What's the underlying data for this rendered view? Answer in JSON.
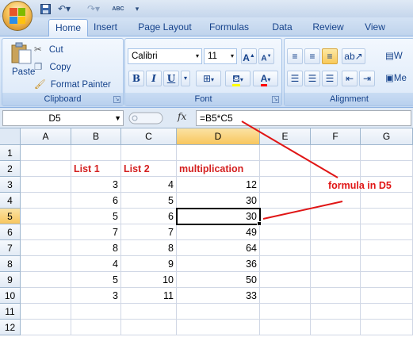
{
  "qat": {
    "save_icon": "save-icon",
    "undo_icon": "undo-icon",
    "redo_icon": "redo-icon",
    "spelling_icon": "spelling-icon",
    "spelling_label": "ABC",
    "customize_icon": "customize-qat-icon"
  },
  "tabs": [
    {
      "label": "Home",
      "active": true
    },
    {
      "label": "Insert"
    },
    {
      "label": "Page Layout"
    },
    {
      "label": "Formulas"
    },
    {
      "label": "Data"
    },
    {
      "label": "Review"
    },
    {
      "label": "View"
    }
  ],
  "ribbon": {
    "clipboard": {
      "group_label": "Clipboard",
      "paste_label": "Paste",
      "cut_label": "Cut",
      "copy_label": "Copy",
      "format_painter_label": "Format Painter"
    },
    "font": {
      "group_label": "Font",
      "font_name": "Calibri",
      "font_size": "11",
      "bold": "B",
      "italic": "I",
      "underline": "U",
      "font_color_glyph": "A"
    },
    "alignment": {
      "group_label": "Alignment",
      "wrap_label": "W",
      "merge_label": "Me"
    }
  },
  "formula_bar": {
    "name_box": "D5",
    "fx": "fx",
    "formula": "=B5*C5"
  },
  "grid": {
    "columns": [
      "A",
      "B",
      "C",
      "D",
      "E",
      "F",
      "G"
    ],
    "selected_column": "D",
    "selected_row": 5,
    "rows": [
      "1",
      "2",
      "3",
      "4",
      "5",
      "6",
      "7",
      "8",
      "9",
      "10",
      "11",
      "12"
    ],
    "headers": {
      "B": "List 1",
      "C": "List 2",
      "D": "multiplication"
    },
    "data": [
      {
        "row": 3,
        "B": "3",
        "C": "4",
        "D": "12"
      },
      {
        "row": 4,
        "B": "6",
        "C": "5",
        "D": "30"
      },
      {
        "row": 5,
        "B": "5",
        "C": "6",
        "D": "30"
      },
      {
        "row": 6,
        "B": "7",
        "C": "7",
        "D": "49"
      },
      {
        "row": 7,
        "B": "8",
        "C": "8",
        "D": "64"
      },
      {
        "row": 8,
        "B": "4",
        "C": "9",
        "D": "36"
      },
      {
        "row": 9,
        "B": "5",
        "C": "10",
        "D": "50"
      },
      {
        "row": 10,
        "B": "3",
        "C": "11",
        "D": "33"
      }
    ]
  },
  "annotation": {
    "label": "formula in D5",
    "color": "#e01515"
  },
  "colors": {
    "header_text": "#d42020",
    "selection_highlight": "#f8c65e"
  }
}
